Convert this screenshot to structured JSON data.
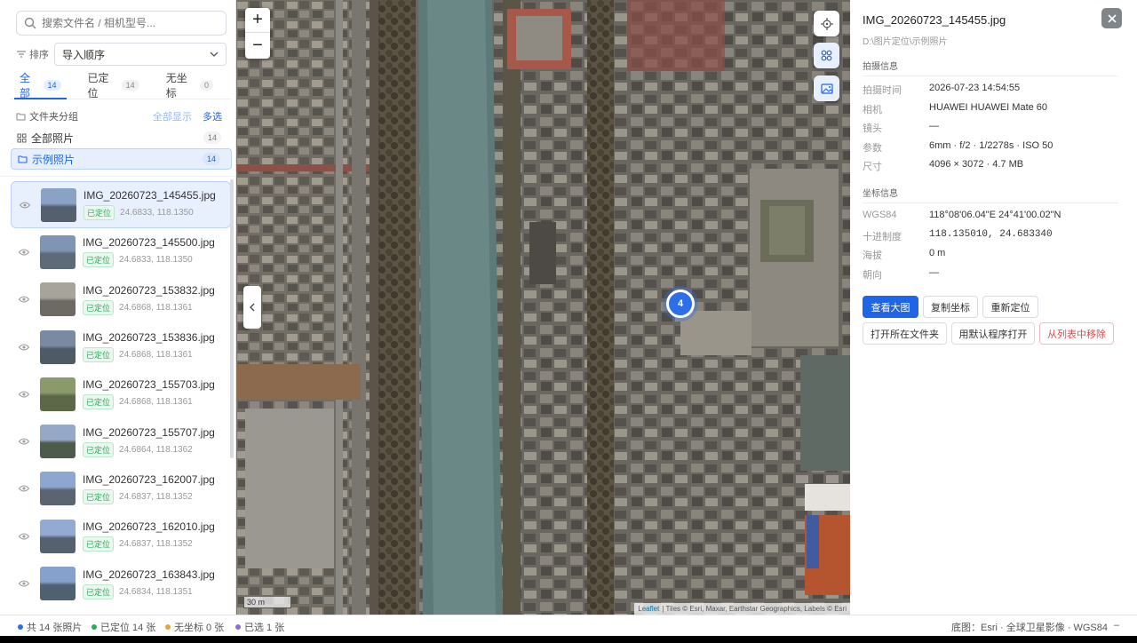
{
  "search": {
    "placeholder": "搜索文件名 / 相机型号..."
  },
  "sort": {
    "label": "排序",
    "value": "导入顺序"
  },
  "tabs": [
    {
      "label": "全部",
      "count": "14"
    },
    {
      "label": "已定位",
      "count": "14"
    },
    {
      "label": "无坐标",
      "count": "0"
    }
  ],
  "groups": {
    "title": "文件夹分组",
    "show_all": "全部显示",
    "multi_select": "多选",
    "folders": [
      {
        "label": "全部照片",
        "count": "14"
      },
      {
        "label": "示例照片",
        "count": "14"
      }
    ]
  },
  "photos": [
    {
      "name": "IMG_20260723_145455.jpg",
      "status": "已定位",
      "coord": "24.6833, 118.1350"
    },
    {
      "name": "IMG_20260723_145500.jpg",
      "status": "已定位",
      "coord": "24.6833, 118.1350"
    },
    {
      "name": "IMG_20260723_153832.jpg",
      "status": "已定位",
      "coord": "24.6868, 118.1361"
    },
    {
      "name": "IMG_20260723_153836.jpg",
      "status": "已定位",
      "coord": "24.6868, 118.1361"
    },
    {
      "name": "IMG_20260723_155703.jpg",
      "status": "已定位",
      "coord": "24.6868, 118.1361"
    },
    {
      "name": "IMG_20260723_155707.jpg",
      "status": "已定位",
      "coord": "24.6864, 118.1362"
    },
    {
      "name": "IMG_20260723_162007.jpg",
      "status": "已定位",
      "coord": "24.6837, 118.1352"
    },
    {
      "name": "IMG_20260723_162010.jpg",
      "status": "已定位",
      "coord": "24.6837, 118.1352"
    },
    {
      "name": "IMG_20260723_163843.jpg",
      "status": "已定位",
      "coord": "24.6834, 118.1351"
    }
  ],
  "map": {
    "zoom_in": "+",
    "zoom_out": "−",
    "cluster_count": "4",
    "scale": "30 m",
    "attribution_leaflet": "Leaflet",
    "attribution_rest": "| Tiles © Esri, Maxar, Earthstar Geographics, Labels © Esri"
  },
  "detail": {
    "title": "IMG_20260723_145455.jpg",
    "path": "D:\\图片定位\\示例照片",
    "shoot_section": "拍摄信息",
    "shoot": [
      {
        "k": "拍摄时间",
        "v": "2026-07-23 14:54:55"
      },
      {
        "k": "相机",
        "v": "HUAWEI HUAWEI Mate 60"
      },
      {
        "k": "镜头",
        "v": "—"
      },
      {
        "k": "参数",
        "v": "6mm · f/2 · 1/2278s · ISO 50"
      },
      {
        "k": "尺寸",
        "v": "4096 × 3072 · 4.7 MB"
      }
    ],
    "coord_section": "坐标信息",
    "coords": [
      {
        "k": "WGS84",
        "v": "118°08'06.04\"E 24°41'00.02\"N"
      },
      {
        "k": "十进制度",
        "v": "118.135010, 24.683340"
      },
      {
        "k": "海拔",
        "v": "0 m"
      },
      {
        "k": "朝向",
        "v": "—"
      }
    ],
    "buttons": {
      "view_large": "查看大图",
      "copy_coord": "复制坐标",
      "relocate": "重新定位",
      "open_folder": "打开所在文件夹",
      "open_default": "用默认程序打开",
      "remove": "从列表中移除"
    }
  },
  "status": {
    "total": "共 14 张照片",
    "located": "已定位 14 张",
    "no_coord": "无坐标 0 张",
    "selected": "已选 1 张",
    "basemap": "底图：Esri · 全球卫星影像 · WGS84",
    "dash": "–"
  },
  "colors": {
    "accent": "#1e66e6",
    "located": "#2eaa5a",
    "no_coord": "#e8a33d",
    "selected": "#8e6ad8"
  }
}
